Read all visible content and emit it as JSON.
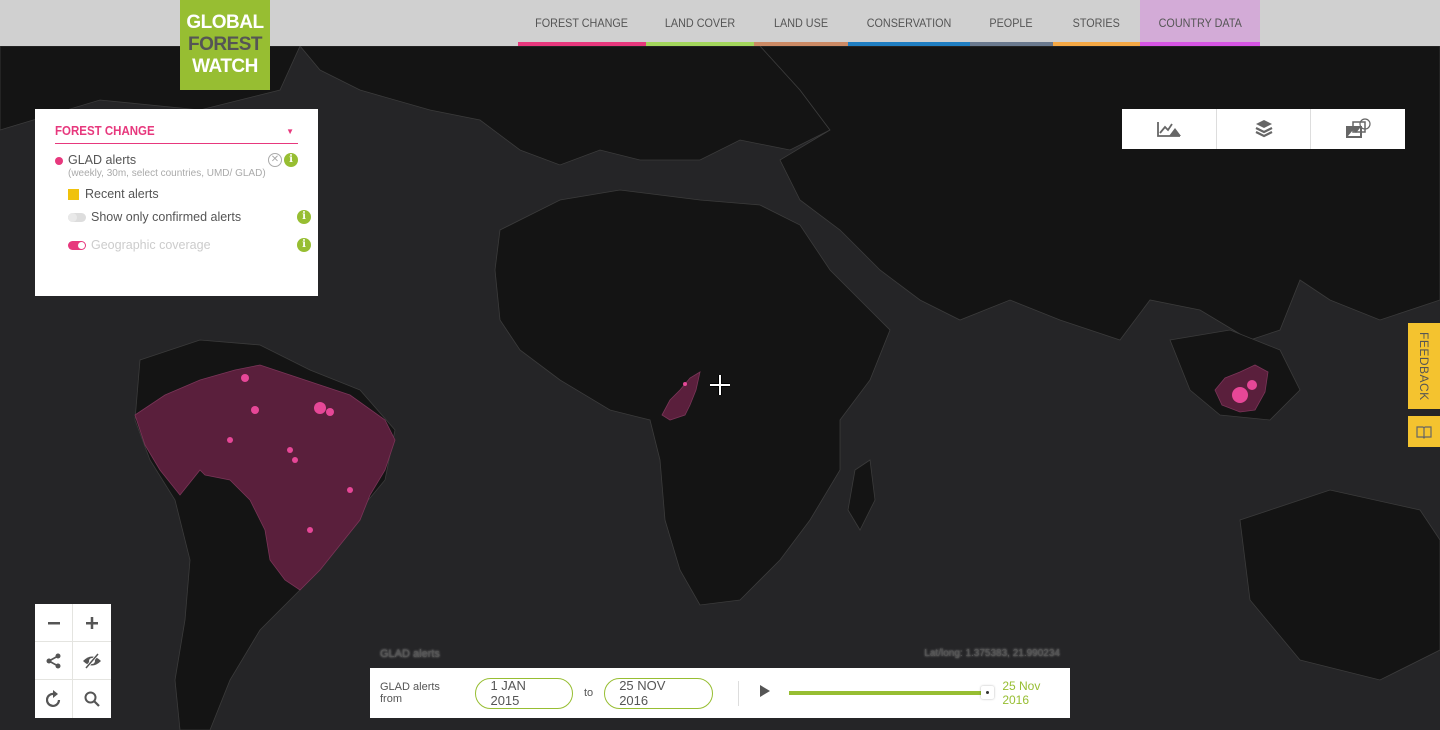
{
  "logo": {
    "line1": "GLOBAL",
    "line2": "FOREST",
    "line3": "WATCH"
  },
  "nav": {
    "items": [
      {
        "label": "FOREST CHANGE",
        "color": "#e7387d"
      },
      {
        "label": "LAND COVER",
        "color": "#a3d65c"
      },
      {
        "label": "LAND USE",
        "color": "#cc8a65"
      },
      {
        "label": "CONSERVATION",
        "color": "#1f7ec2"
      },
      {
        "label": "PEOPLE",
        "color": "#6b7a8f"
      },
      {
        "label": "STORIES",
        "color": "#f5a844"
      },
      {
        "label": "COUNTRY DATA",
        "color": "#d655e4"
      }
    ]
  },
  "layer_panel": {
    "title": "FOREST CHANGE",
    "layer": {
      "name": "GLAD alerts",
      "description": "(weekly, 30m, select countries, UMD/ GLAD)",
      "legend_label": "Recent alerts",
      "legend_color": "#f0c20c",
      "options": [
        {
          "label": "Show only confirmed alerts",
          "enabled": false
        },
        {
          "label": "Geographic coverage",
          "enabled": true
        }
      ]
    }
  },
  "tools": [
    {
      "icon": "analysis-icon"
    },
    {
      "icon": "layers-icon"
    },
    {
      "icon": "basemaps-icon"
    }
  ],
  "feedback": {
    "label": "FEEDBACK"
  },
  "map_controls": [
    "zoom-out",
    "zoom-in",
    "share",
    "hide-ui",
    "reset",
    "search"
  ],
  "timeline": {
    "layer_label": "GLAD alerts",
    "latlng": "Lat/long: 1.375383, 21.990234",
    "from_label": "GLAD alerts from",
    "start_date": "1 JAN 2015",
    "to_label": "to",
    "end_date": "25 NOV 2016",
    "current_date": "25 Nov 2016",
    "progress": 1.0
  },
  "colors": {
    "accent_green": "#97be32",
    "accent_pink": "#e7387d",
    "alert_fill": "#5a1f3c",
    "alert_hot": "#ff4fa8"
  }
}
